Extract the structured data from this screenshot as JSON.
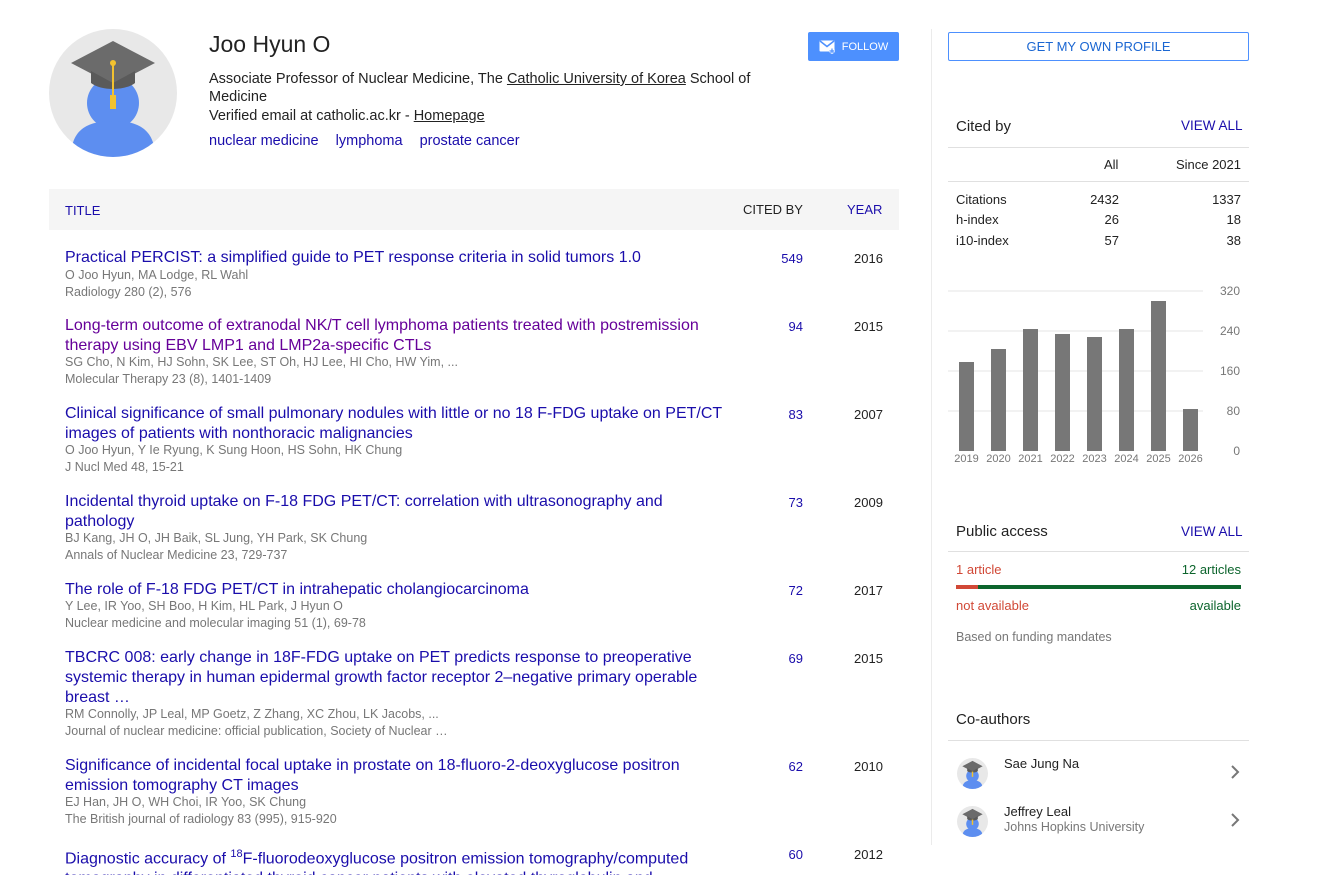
{
  "profile": {
    "name": "Joo Hyun O",
    "affiliation_pre": "Associate Professor of Nuclear Medicine, The ",
    "affiliation_link": "Catholic University of Korea",
    "affiliation_post": " School of Medicine",
    "email_text": "Verified email at catholic.ac.kr - ",
    "homepage_label": "Homepage",
    "interests": [
      "nuclear medicine",
      "lymphoma",
      "prostate cancer"
    ],
    "follow_label": "FOLLOW"
  },
  "table": {
    "header_title": "TITLE",
    "header_cited": "CITED BY",
    "header_year": "YEAR",
    "rows": [
      {
        "title": "Practical PERCIST: a simplified guide to PET response criteria in solid tumors 1.0",
        "authors": "O Joo Hyun, MA Lodge, RL Wahl",
        "venue": "Radiology 280 (2), 576",
        "cited": "549",
        "year": "2016"
      },
      {
        "title": "Long-term outcome of extranodal NK/T cell lymphoma patients treated with postremission therapy using EBV LMP1 and LMP2a-specific CTLs",
        "authors": "SG Cho, N Kim, HJ Sohn, SK Lee, ST Oh, HJ Lee, HI Cho, HW Yim, ...",
        "venue": "Molecular Therapy 23 (8), 1401-1409",
        "cited": "94",
        "year": "2015"
      },
      {
        "title": "Clinical significance of small pulmonary nodules with little or no 18 F-FDG uptake on PET/CT images of patients with nonthoracic malignancies",
        "authors": "O Joo Hyun, Y Ie Ryung, K Sung Hoon, HS Sohn, HK Chung",
        "venue": "J Nucl Med 48, 15-21",
        "cited": "83",
        "year": "2007"
      },
      {
        "title": "Incidental thyroid uptake on F-18 FDG PET/CT: correlation with ultrasonography and pathology",
        "authors": "BJ Kang, JH O, JH Baik, SL Jung, YH Park, SK Chung",
        "venue": "Annals of Nuclear Medicine 23, 729-737",
        "cited": "73",
        "year": "2009"
      },
      {
        "title": "The role of F-18 FDG PET/CT in intrahepatic cholangiocarcinoma",
        "authors": "Y Lee, IR Yoo, SH Boo, H Kim, HL Park, J Hyun O",
        "venue": "Nuclear medicine and molecular imaging 51 (1), 69-78",
        "cited": "72",
        "year": "2017"
      },
      {
        "title": "TBCRC 008: early change in 18F-FDG uptake on PET predicts response to preoperative systemic therapy in human epidermal growth factor receptor 2–negative primary operable breast …",
        "authors": "RM Connolly, JP Leal, MP Goetz, Z Zhang, XC Zhou, LK Jacobs, ...",
        "venue": "Journal of nuclear medicine: official publication, Society of Nuclear …",
        "cited": "69",
        "year": "2015"
      },
      {
        "title": "Significance of incidental focal uptake in prostate on 18-fluoro-2-deoxyglucose positron emission tomography CT images",
        "authors": "EJ Han, JH O, WH Choi, IR Yoo, SK Chung",
        "venue": "The British journal of radiology 83 (995), 915-920",
        "cited": "62",
        "year": "2010"
      },
      {
        "title_pre": "Diagnostic accuracy of ",
        "title_sup": "18",
        "title_post": "F-fluorodeoxyglucose positron emission tomography/computed tomography in differentiated thyroid cancer patients with elevated thyroglobulin and",
        "authors": "",
        "venue": "",
        "cited": "60",
        "year": "2012"
      }
    ]
  },
  "sidebar": {
    "get_profile_label": "GET MY OWN PROFILE",
    "cited_by_title": "Cited by",
    "view_all_label": "VIEW ALL",
    "col_all": "All",
    "col_since": "Since 2021",
    "stats": [
      {
        "label": "Citations",
        "all": "2432",
        "since": "1337"
      },
      {
        "label": "h-index",
        "all": "26",
        "since": "18"
      },
      {
        "label": "i10-index",
        "all": "57",
        "since": "38"
      }
    ],
    "public_access_title": "Public access",
    "pa_not_available_count": "1 article",
    "pa_available_count": "12 articles",
    "pa_not_available_label": "not available",
    "pa_available_label": "available",
    "pa_note": "Based on funding mandates",
    "pa_fraction_not_available": 0.077,
    "coauthors_title": "Co-authors",
    "coauthors": [
      {
        "name": "Sae Jung Na",
        "affiliation": ""
      },
      {
        "name": "Jeffrey Leal",
        "affiliation": "Johns Hopkins University"
      }
    ]
  },
  "colors": {
    "link": "#1a0dab",
    "visited": "#660099",
    "button": "#4d90fe",
    "bar": "#777777",
    "not_available": "#d14836",
    "available": "#0d652d"
  },
  "chart_data": {
    "type": "bar",
    "categories": [
      "2019",
      "2020",
      "2021",
      "2022",
      "2023",
      "2024",
      "2025",
      "2026"
    ],
    "values": [
      178,
      204,
      244,
      234,
      228,
      244,
      300,
      84
    ],
    "yticks": [
      0,
      80,
      160,
      240,
      320
    ],
    "ylim": [
      0,
      320
    ],
    "grid": true
  }
}
